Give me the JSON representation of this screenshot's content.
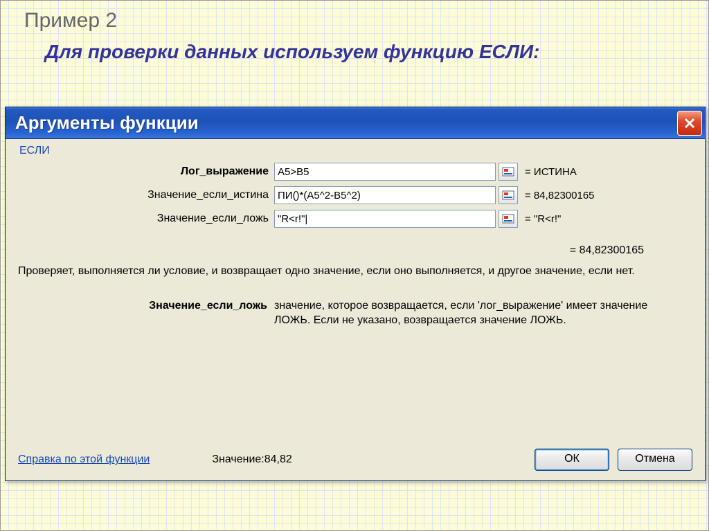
{
  "slide": {
    "title1": "Пример 2",
    "title2": "Для проверки данных  используем функцию ЕСЛИ:"
  },
  "dialog": {
    "title": "Аргументы функции",
    "function_name": "ЕСЛИ",
    "args": [
      {
        "label": "Лог_выражение",
        "bold": true,
        "value": "A5>B5",
        "result": "= ИСТИНА"
      },
      {
        "label": "Значение_если_истина",
        "bold": false,
        "value": "ПИ()*(A5^2-B5^2)",
        "result": "= 84,82300165"
      },
      {
        "label": "Значение_если_ложь",
        "bold": false,
        "value": "\"R<r!\"|",
        "result": "= \"R<r!\""
      }
    ],
    "formula_result": "= 84,82300165",
    "description": "Проверяет, выполняется ли условие, и возвращает одно значение, если оно выполняется, и другое значение, если нет.",
    "param_desc": {
      "label": "Значение_если_ложь",
      "text": "значение, которое возвращается, если 'лог_выражение' имеет значение ЛОЖЬ. Если не указано, возвращается значение ЛОЖЬ."
    },
    "help_link": "Справка по этой функции",
    "value_label": "Значение:84,82",
    "ok_button": "ОК",
    "cancel_button": "Отмена"
  }
}
